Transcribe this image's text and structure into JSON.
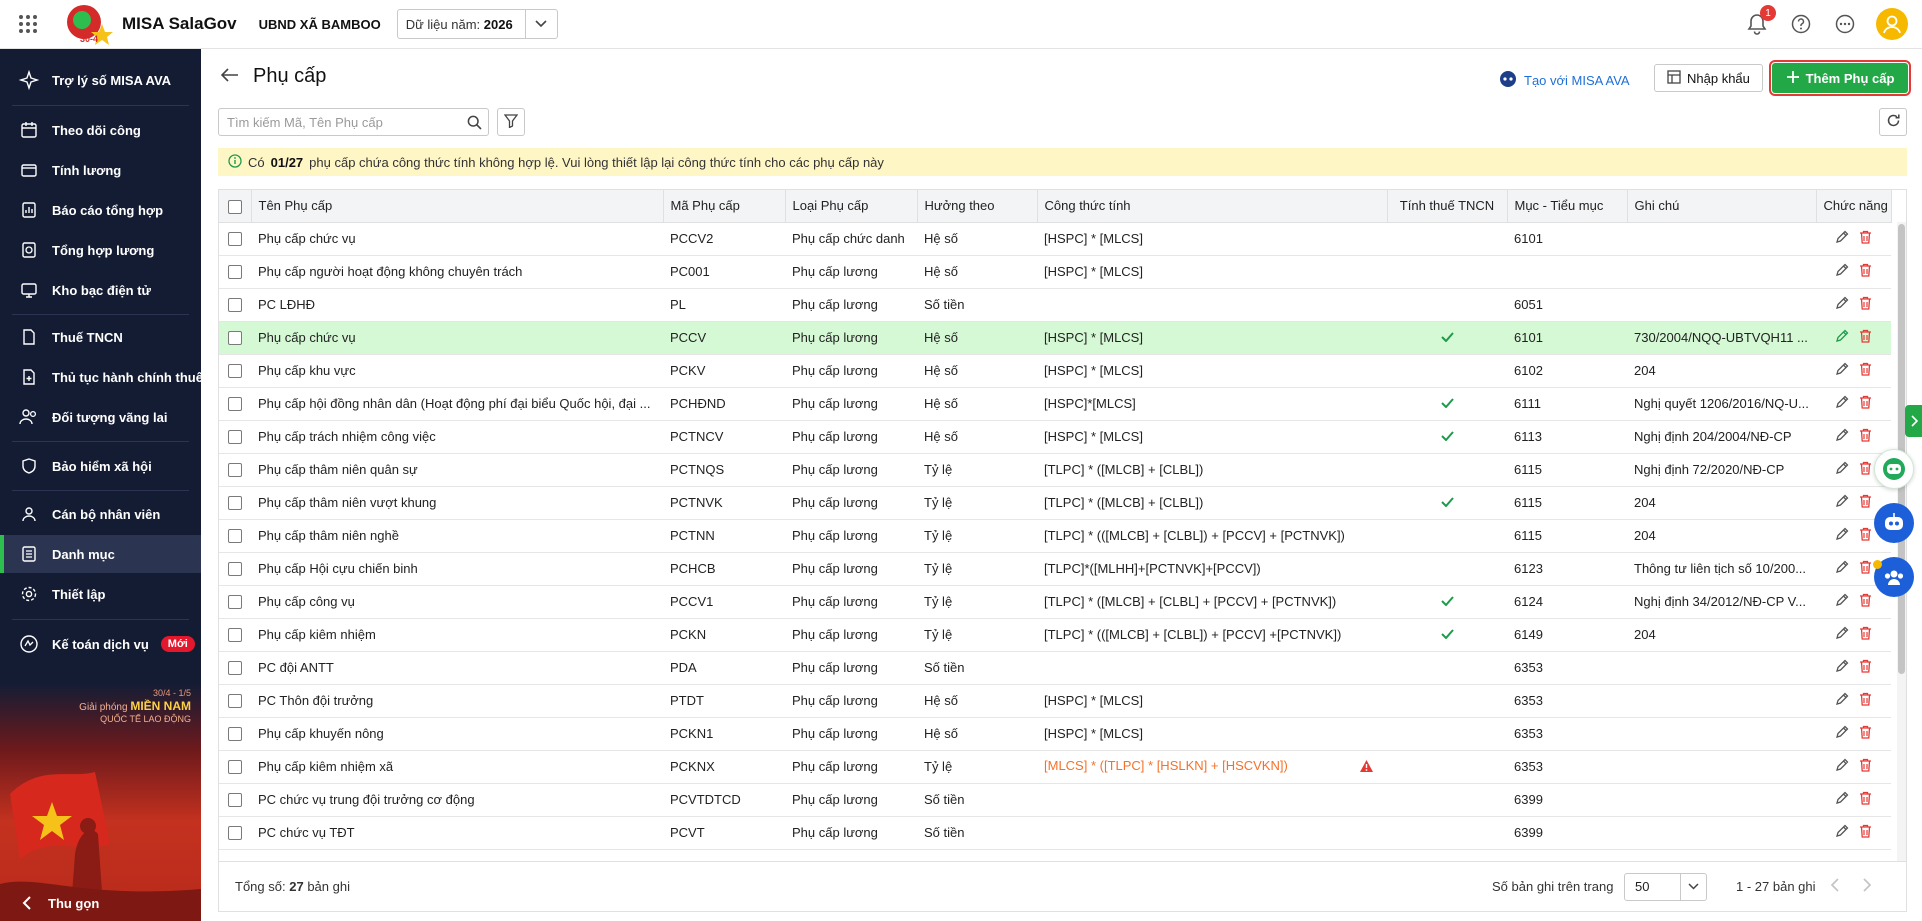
{
  "app": {
    "name": "MISA SalaGov",
    "org": "UBND XÃ BAMBOO",
    "year_label": "Dữ liệu năm:",
    "year_value": "2026",
    "notification_count": "1",
    "logo_text": "30-4"
  },
  "sidebar": {
    "items": [
      {
        "label": "Trợ lý số MISA AVA",
        "icon": "sparkle-icon"
      },
      {
        "label": "Theo dõi công",
        "icon": "calendar-icon"
      },
      {
        "label": "Tính lương",
        "icon": "wallet-icon"
      },
      {
        "label": "Báo cáo tổng hợp",
        "icon": "report-icon"
      },
      {
        "label": "Tổng hợp lương",
        "icon": "salary-summary-icon"
      },
      {
        "label": "Kho bạc điện tử",
        "icon": "treasury-icon"
      },
      {
        "label": "Thuế TNCN",
        "icon": "tax-icon"
      },
      {
        "label": "Thủ tục hành chính thuế",
        "icon": "procedure-icon"
      },
      {
        "label": "Đối tượng vãng lai",
        "icon": "people-icon"
      },
      {
        "label": "Bảo hiểm xã hội",
        "icon": "insurance-icon"
      },
      {
        "label": "Cán bộ nhân viên",
        "icon": "employee-icon"
      },
      {
        "label": "Danh mục",
        "icon": "list-icon"
      },
      {
        "label": "Thiết lập",
        "icon": "gear-icon"
      },
      {
        "label": "Kế toán dịch vụ",
        "icon": "accounting-icon",
        "badge": "Mới"
      }
    ],
    "banner": {
      "line1": "30/4 - 1/5",
      "line2_prefix": "Giải phóng",
      "line2_highlight": "MIỀN NAM",
      "line3": "QUỐC TẾ LAO ĐỘNG"
    },
    "collapse_label": "Thu gọn"
  },
  "page": {
    "title": "Phụ cấp",
    "ava_link": "Tạo với MISA AVA",
    "import_label": "Nhập khẩu",
    "add_label": "Thêm Phụ cấp",
    "search_placeholder": "Tìm kiếm Mã, Tên Phụ cấp",
    "warning": {
      "prefix": "Có",
      "count": "01/27",
      "suffix": "phụ cấp chứa công thức tính không hợp lệ. Vui lòng thiết lập lại công thức tính cho các phụ cấp này"
    }
  },
  "table": {
    "columns": [
      "Tên Phụ cấp",
      "Mã Phụ cấp",
      "Loại Phụ cấp",
      "Hưởng theo",
      "Công thức tính",
      "Tính thuế TNCN",
      "Mục - Tiểu mục",
      "Ghi chú",
      "Chức năng"
    ],
    "rows": [
      {
        "name": "Phụ cấp chức vụ",
        "code": "PCCV2",
        "type": "Phụ cấp chức danh",
        "basis": "Hệ số",
        "formula": "[HSPC] * [MLCS]",
        "tax": false,
        "item": "6101",
        "note": "",
        "invalid": false,
        "highlight": false
      },
      {
        "name": "Phụ cấp người hoạt động không chuyên trách",
        "code": "PC001",
        "type": "Phụ cấp lương",
        "basis": "Hệ số",
        "formula": "[HSPC] * [MLCS]",
        "tax": false,
        "item": "",
        "note": "",
        "invalid": false,
        "highlight": false
      },
      {
        "name": "PC LĐHĐ",
        "code": "PL",
        "type": "Phụ cấp lương",
        "basis": "Số tiền",
        "formula": "",
        "tax": false,
        "item": "6051",
        "note": "",
        "invalid": false,
        "highlight": false
      },
      {
        "name": "Phụ cấp chức vụ",
        "code": "PCCV",
        "type": "Phụ cấp lương",
        "basis": "Hệ số",
        "formula": "[HSPC] * [MLCS]",
        "tax": true,
        "item": "6101",
        "note": "730/2004/NQQ-UBTVQH11 ...",
        "invalid": false,
        "highlight": true
      },
      {
        "name": "Phụ cấp khu vực",
        "code": "PCKV",
        "type": "Phụ cấp lương",
        "basis": "Hệ số",
        "formula": "[HSPC] * [MLCS]",
        "tax": false,
        "item": "6102",
        "note": "204",
        "invalid": false,
        "highlight": false
      },
      {
        "name": "Phụ cấp hội đồng nhân dân (Hoạt động phí đại biểu Quốc hội, đại ...",
        "code": "PCHĐND",
        "type": "Phụ cấp lương",
        "basis": "Hệ số",
        "formula": "[HSPC]*[MLCS]",
        "tax": true,
        "item": "6111",
        "note": "Nghị quyết 1206/2016/NQ-U...",
        "invalid": false,
        "highlight": false
      },
      {
        "name": "Phụ cấp trách nhiệm công việc",
        "code": "PCTNCV",
        "type": "Phụ cấp lương",
        "basis": "Hệ số",
        "formula": "[HSPC] * [MLCS]",
        "tax": true,
        "item": "6113",
        "note": "Nghị định 204/2004/NĐ-CP",
        "invalid": false,
        "highlight": false
      },
      {
        "name": "Phụ cấp thâm niên quân sự",
        "code": "PCTNQS",
        "type": "Phụ cấp lương",
        "basis": "Tỷ lệ",
        "formula": "[TLPC] * ([MLCB] + [CLBL])",
        "tax": false,
        "item": "6115",
        "note": "Nghị định 72/2020/NĐ-CP",
        "invalid": false,
        "highlight": false
      },
      {
        "name": "Phụ cấp thâm niên vượt khung",
        "code": "PCTNVK",
        "type": "Phụ cấp lương",
        "basis": "Tỷ lệ",
        "formula": "[TLPC] * ([MLCB] + [CLBL])",
        "tax": true,
        "item": "6115",
        "note": "204",
        "invalid": false,
        "highlight": false
      },
      {
        "name": "Phụ cấp thâm niên nghề",
        "code": "PCTNN",
        "type": "Phụ cấp lương",
        "basis": "Tỷ lệ",
        "formula": "[TLPC] * (([MLCB] + [CLBL]) + [PCCV] + [PCTNVK])",
        "tax": false,
        "item": "6115",
        "note": "204",
        "invalid": false,
        "highlight": false
      },
      {
        "name": "Phụ cấp Hội cựu chiến binh",
        "code": "PCHCB",
        "type": "Phụ cấp lương",
        "basis": "Tỷ lệ",
        "formula": "[TLPC]*([MLHH]+[PCTNVK]+[PCCV])",
        "tax": false,
        "item": "6123",
        "note": "Thông tư liên tịch số 10/200...",
        "invalid": false,
        "highlight": false
      },
      {
        "name": "Phụ cấp công vụ",
        "code": "PCCV1",
        "type": "Phụ cấp lương",
        "basis": "Tỷ lệ",
        "formula": "[TLPC] * ([MLCB] + [CLBL] + [PCCV] + [PCTNVK])",
        "tax": true,
        "item": "6124",
        "note": "Nghị định 34/2012/NĐ-CP V...",
        "invalid": false,
        "highlight": false
      },
      {
        "name": "Phụ cấp kiêm nhiệm",
        "code": "PCKN",
        "type": "Phụ cấp lương",
        "basis": "Tỷ lệ",
        "formula": "[TLPC] * (([MLCB] + [CLBL]) + [PCCV] +[PCTNVK])",
        "tax": true,
        "item": "6149",
        "note": "204",
        "invalid": false,
        "highlight": false
      },
      {
        "name": "PC đội ANTT",
        "code": "PDA",
        "type": "Phụ cấp lương",
        "basis": "Số tiền",
        "formula": "",
        "tax": false,
        "item": "6353",
        "note": "",
        "invalid": false,
        "highlight": false
      },
      {
        "name": "PC Thôn đội trưởng",
        "code": "PTDT",
        "type": "Phụ cấp lương",
        "basis": "Hệ số",
        "formula": "[HSPC] * [MLCS]",
        "tax": false,
        "item": "6353",
        "note": "",
        "invalid": false,
        "highlight": false
      },
      {
        "name": "Phụ cấp khuyến nông",
        "code": "PCKN1",
        "type": "Phụ cấp lương",
        "basis": "Hệ số",
        "formula": "[HSPC] * [MLCS]",
        "tax": false,
        "item": "6353",
        "note": "",
        "invalid": false,
        "highlight": false
      },
      {
        "name": "Phụ cấp kiêm nhiệm xã",
        "code": "PCKNX",
        "type": "Phụ cấp lương",
        "basis": "Tỷ lệ",
        "formula": "[MLCS] * ([TLPC] * [HSLKN] + [HSCVKN])",
        "tax": false,
        "item": "6353",
        "note": "",
        "invalid": true,
        "highlight": false
      },
      {
        "name": "PC chức vụ trung đội trưởng cơ động",
        "code": "PCVTDTCD",
        "type": "Phụ cấp lương",
        "basis": "Số tiền",
        "formula": "",
        "tax": false,
        "item": "6399",
        "note": "",
        "invalid": false,
        "highlight": false
      },
      {
        "name": "PC chức vụ TĐT",
        "code": "PCVT",
        "type": "Phụ cấp lương",
        "basis": "Số tiền",
        "formula": "",
        "tax": false,
        "item": "6399",
        "note": "",
        "invalid": false,
        "highlight": false
      }
    ]
  },
  "footer": {
    "total_label": "Tổng số:",
    "total_count": "27",
    "total_unit": "bản ghi",
    "per_page_label": "Số bản ghi trên trang",
    "per_page_value": "50",
    "range": "1 - 27 bản ghi"
  },
  "colors": {
    "sidebar_bg": "#141c34",
    "accent_green": "#23a847",
    "highlight_row": "#d5f8d5",
    "warning_bg": "#fff6c5",
    "error_orange": "#f5712b",
    "delete_red": "#e53935",
    "link_blue": "#1e6fd9"
  }
}
